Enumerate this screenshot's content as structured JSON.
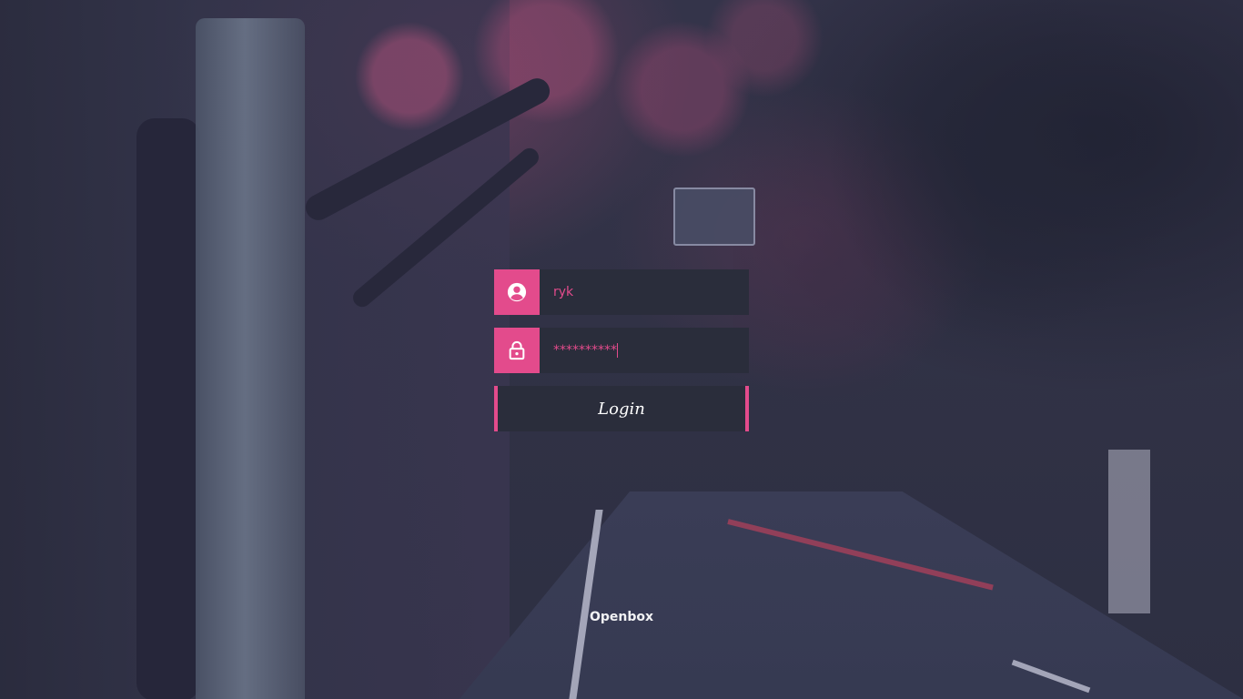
{
  "login": {
    "username_value": "ryk",
    "password_value": "**********",
    "button_label": "Login",
    "accent_color": "#e34b8c",
    "field_background": "#2a2d3b"
  },
  "session": {
    "label": "Openbox"
  },
  "icons": {
    "user": "user-circle-icon",
    "password": "padlock-icon"
  }
}
